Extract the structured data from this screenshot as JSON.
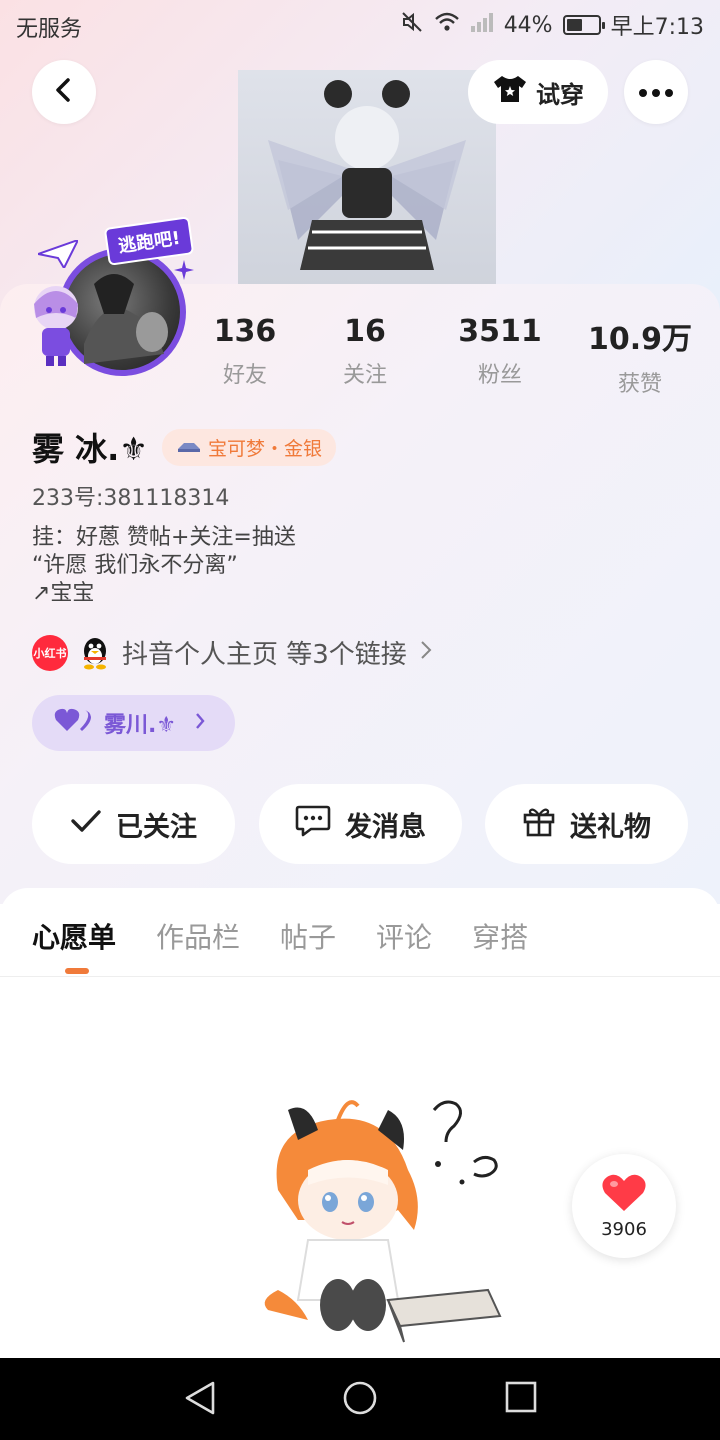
{
  "status_bar": {
    "carrier": "无服务",
    "battery_percent": "44%",
    "time": "早上7:13"
  },
  "header": {
    "try_on_label": "试穿"
  },
  "avatar_frame": {
    "tag_text": "逃跑吧!"
  },
  "stats": [
    {
      "value": "136",
      "label": "好友"
    },
    {
      "value": "16",
      "label": "关注"
    },
    {
      "value": "3511",
      "label": "粉丝"
    },
    {
      "value": "10.9万",
      "label": "获赞"
    }
  ],
  "profile": {
    "username": "雾 冰.⚜",
    "badge_text": "宝可梦・金银",
    "uid": "233号:381118314",
    "bio_lines": [
      "挂：好蒽 赞帖+关注=抽送",
      "“许愿 我们永不分离”",
      "↗宝宝"
    ],
    "links_text": "抖音个人主页 等3个链接",
    "xhs_label": "小红书",
    "cp_name": "雾川.⚜"
  },
  "actions": {
    "follow_label": "已关注",
    "message_label": "发消息",
    "gift_label": "送礼物"
  },
  "tabs": [
    {
      "label": "心愿单",
      "active": true
    },
    {
      "label": "作品栏",
      "active": false
    },
    {
      "label": "帖子",
      "active": false
    },
    {
      "label": "评论",
      "active": false
    },
    {
      "label": "穿搭",
      "active": false
    }
  ],
  "like_float": {
    "count": "3906"
  },
  "colors": {
    "accent": "#f07a3a",
    "cp_purple": "#7b58d6",
    "heart_red": "#ff3b47"
  }
}
